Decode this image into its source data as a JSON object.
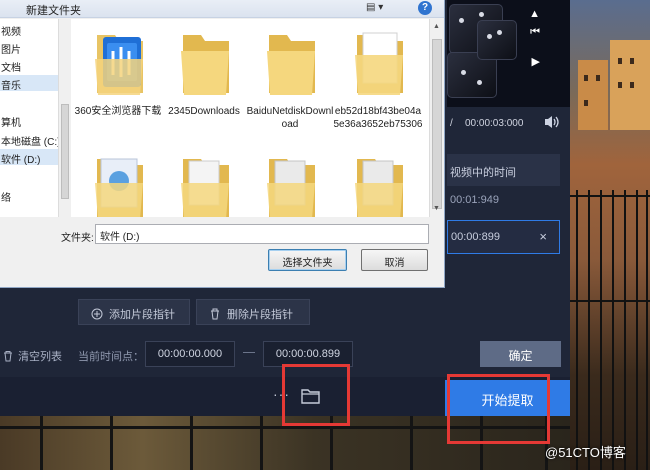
{
  "dialog": {
    "title": "新建文件夹",
    "view_button": "▤ ▾",
    "help_icon": "?",
    "nav_items": [
      {
        "label": "视频",
        "selected": false
      },
      {
        "label": "图片",
        "selected": false
      },
      {
        "label": "文档",
        "selected": false
      },
      {
        "label": "音乐",
        "selected": true
      },
      {
        "label": "",
        "selected": false
      },
      {
        "label": "算机",
        "selected": false
      },
      {
        "label": "本地磁盘 (C:)",
        "selected": false
      },
      {
        "label": "软件 (D:)",
        "selected": true
      },
      {
        "label": "",
        "selected": false
      },
      {
        "label": "络",
        "selected": false
      }
    ],
    "files": [
      {
        "name": "360安全浏览器下载",
        "icon": "folder-360-icon"
      },
      {
        "name": "2345Downloads",
        "icon": "folder-icon"
      },
      {
        "name": "BaiduNetdiskDownload",
        "icon": "folder-icon"
      },
      {
        "name": "eb52d18bf43be04a5e36a3652eb75306",
        "icon": "folder-doc-icon"
      },
      {
        "name": "",
        "icon": "folder-media-icon"
      },
      {
        "name": "",
        "icon": "folder-icon"
      },
      {
        "name": "",
        "icon": "folder-icon"
      },
      {
        "name": "",
        "icon": "folder-icon"
      }
    ],
    "folder_label": "文件夹:",
    "folder_value": "软件 (D:)",
    "select_button": "选择文件夹",
    "cancel_button": "取消"
  },
  "player": {
    "total_time": "00:00:03:000",
    "slash": "/"
  },
  "right_panel": {
    "header": "视频中的时间",
    "row1": "00:01:949",
    "row2": "00:00:899",
    "clear_x": "×"
  },
  "toolbar": {
    "add_segment": "添加片段指针",
    "delete_segment": "删除片段指针",
    "clear_list": "清空列表",
    "timepoint_label": "当前时间点：",
    "start_time": "00:00:00.000",
    "end_time": "00:00:00.899",
    "confirm": "确定"
  },
  "bottom": {
    "more_dots": "···",
    "extract_button": "开始提取"
  },
  "colors": {
    "accent": "#2f7be6",
    "highlight": "#e53935",
    "app_bg": "#1f2638"
  },
  "watermark": "@51CTO博客"
}
